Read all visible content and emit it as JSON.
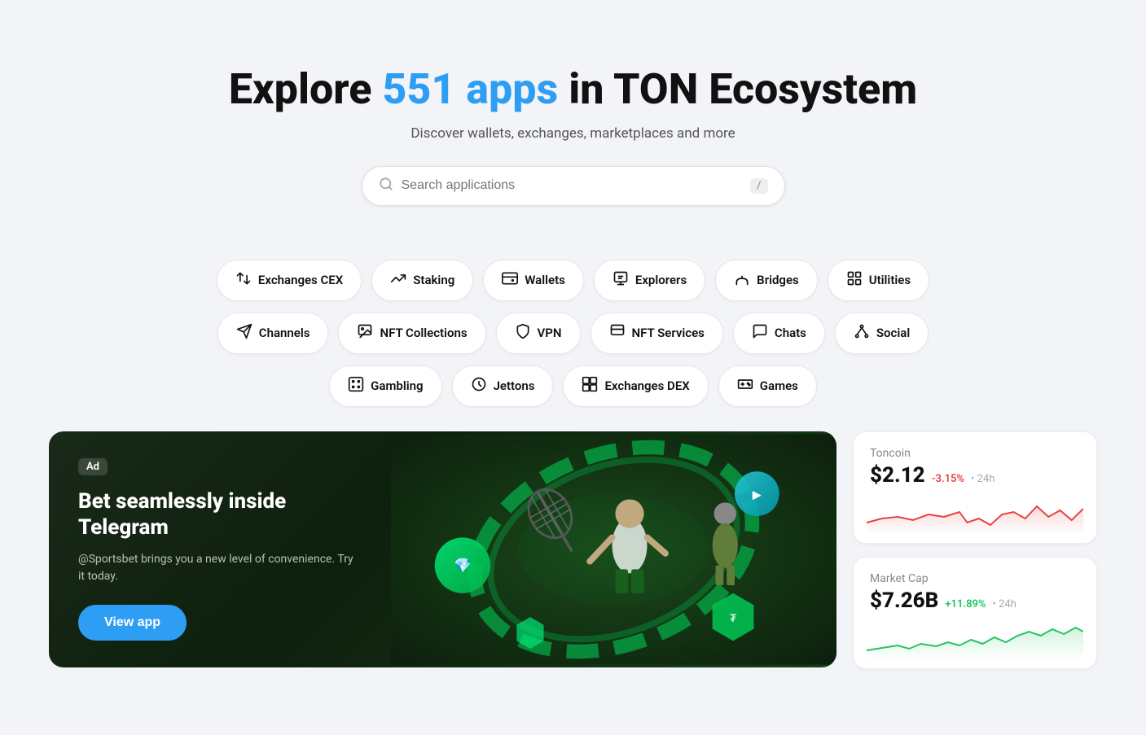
{
  "hero": {
    "title_prefix": "Explore ",
    "title_count": "551",
    "title_middle": " apps",
    "title_suffix": " in TON Ecosystem",
    "subtitle": "Discover wallets, exchanges, marketplaces and more"
  },
  "search": {
    "placeholder": "Search applications",
    "shortcut": "/"
  },
  "categories": {
    "row1": [
      {
        "id": "exchanges-cex",
        "label": "Exchanges CEX",
        "icon": "⇄"
      },
      {
        "id": "staking",
        "label": "Staking",
        "icon": "⬆"
      },
      {
        "id": "wallets",
        "label": "Wallets",
        "icon": "💳"
      },
      {
        "id": "explorers",
        "label": "Explorers",
        "icon": "🔭"
      },
      {
        "id": "bridges",
        "label": "Bridges",
        "icon": "⊞"
      },
      {
        "id": "utilities",
        "label": "Utilities",
        "icon": "⊟"
      }
    ],
    "row2": [
      {
        "id": "channels",
        "label": "Channels",
        "icon": "✈"
      },
      {
        "id": "nft-collections",
        "label": "NFT Collections",
        "icon": "🖼"
      },
      {
        "id": "vpn",
        "label": "VPN",
        "icon": "🛡"
      },
      {
        "id": "nft-services",
        "label": "NFT Services",
        "icon": "🖼"
      },
      {
        "id": "chats",
        "label": "Chats",
        "icon": "💬"
      },
      {
        "id": "social",
        "label": "Social",
        "icon": "👥"
      }
    ],
    "row3": [
      {
        "id": "gambling",
        "label": "Gambling",
        "icon": "🎲"
      },
      {
        "id": "jettons",
        "label": "Jettons",
        "icon": "⚙"
      },
      {
        "id": "exchanges-dex",
        "label": "Exchanges DEX",
        "icon": "⊡"
      },
      {
        "id": "games",
        "label": "Games",
        "icon": "🎮"
      }
    ]
  },
  "ad": {
    "badge": "Ad",
    "title": "Bet seamlessly inside Telegram",
    "description": "@Sportsbet brings you a new level of convenience. Try it today.",
    "cta": "View app"
  },
  "toncoin": {
    "label": "Toncoin",
    "value": "$2.12",
    "change": "-3.15%",
    "period": "• 24h",
    "chart_color": "#e84040",
    "chart_fill": "rgba(232,64,64,0.1)"
  },
  "marketcap": {
    "label": "Market Cap",
    "value": "$7.26B",
    "change": "+11.89%",
    "period": "• 24h",
    "chart_color": "#22c55e",
    "chart_fill": "rgba(34,197,94,0.1)"
  },
  "colors": {
    "accent_blue": "#2e9ef4",
    "background": "#f2f4f7",
    "card_bg": "#ffffff"
  }
}
